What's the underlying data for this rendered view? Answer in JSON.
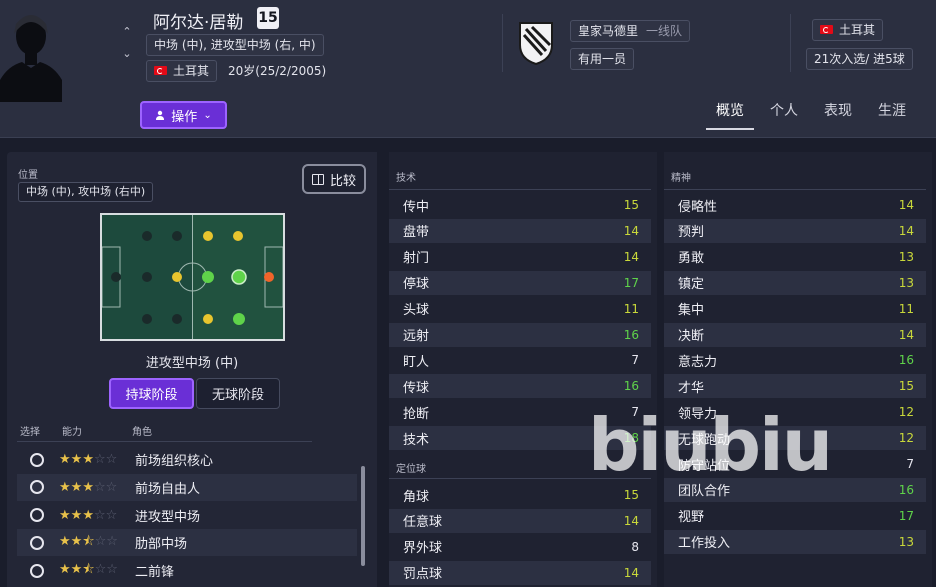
{
  "header": {
    "player_name": "阿尔达·居勒",
    "shirt_number": "15",
    "positions": "中场 (中), 进攻型中场 (右, 中)",
    "nationality": "土耳其",
    "age_dob": "20岁(25/2/2005)",
    "action_label": "操作",
    "club_name": "皇家马德里",
    "club_team": "一线队",
    "club_status": "有用一员",
    "intl_nation": "土耳其",
    "intl_stats": "21次入选/ 进5球",
    "flag_color": "#e30a17",
    "accent_color": "#6a2fd6"
  },
  "tabs": [
    {
      "label": "概览",
      "active": true
    },
    {
      "label": "个人",
      "active": false
    },
    {
      "label": "表现",
      "active": false
    },
    {
      "label": "生涯",
      "active": false
    }
  ],
  "left": {
    "position_label": "位置",
    "position_value": "中场 (中), 攻中场 (右中)",
    "compare_label": "比较",
    "pitch_role": "进攻型中场 (中)",
    "phase_in": "持球阶段",
    "phase_out": "无球阶段",
    "col_select": "选择",
    "col_ability": "能力",
    "col_role": "角色",
    "roles": [
      {
        "name": "前场组织核心",
        "stars": 3
      },
      {
        "name": "前场自由人",
        "stars": 3
      },
      {
        "name": "进攻型中场",
        "stars": 3
      },
      {
        "name": "肋部中场",
        "stars": 2.5
      },
      {
        "name": "二前锋",
        "stars": 2.5
      }
    ]
  },
  "technical": {
    "title": "技术",
    "items": [
      {
        "name": "传中",
        "value": "15"
      },
      {
        "name": "盘带",
        "value": "14"
      },
      {
        "name": "射门",
        "value": "14"
      },
      {
        "name": "停球",
        "value": "17"
      },
      {
        "name": "头球",
        "value": "11"
      },
      {
        "name": "远射",
        "value": "16"
      },
      {
        "name": "盯人",
        "value": "7"
      },
      {
        "name": "传球",
        "value": "16"
      },
      {
        "name": "抢断",
        "value": "7"
      },
      {
        "name": "技术",
        "value": "18"
      }
    ]
  },
  "set_pieces": {
    "title": "定位球",
    "items": [
      {
        "name": "角球",
        "value": "15"
      },
      {
        "name": "任意球",
        "value": "14"
      },
      {
        "name": "界外球",
        "value": "8"
      },
      {
        "name": "罚点球",
        "value": "14"
      }
    ]
  },
  "mental": {
    "title": "精神",
    "items": [
      {
        "name": "侵略性",
        "value": "14"
      },
      {
        "name": "预判",
        "value": "14"
      },
      {
        "name": "勇敢",
        "value": "13"
      },
      {
        "name": "镇定",
        "value": "13"
      },
      {
        "name": "集中",
        "value": "11"
      },
      {
        "name": "决断",
        "value": "14"
      },
      {
        "name": "意志力",
        "value": "16"
      },
      {
        "name": "才华",
        "value": "15"
      },
      {
        "name": "领导力",
        "value": "12"
      },
      {
        "name": "无球跑动",
        "value": "12"
      },
      {
        "name": "防守站位",
        "value": "7"
      },
      {
        "name": "团队合作",
        "value": "16"
      },
      {
        "name": "视野",
        "value": "17"
      },
      {
        "name": "工作投入",
        "value": "13"
      }
    ]
  },
  "watermark": "biubiu"
}
